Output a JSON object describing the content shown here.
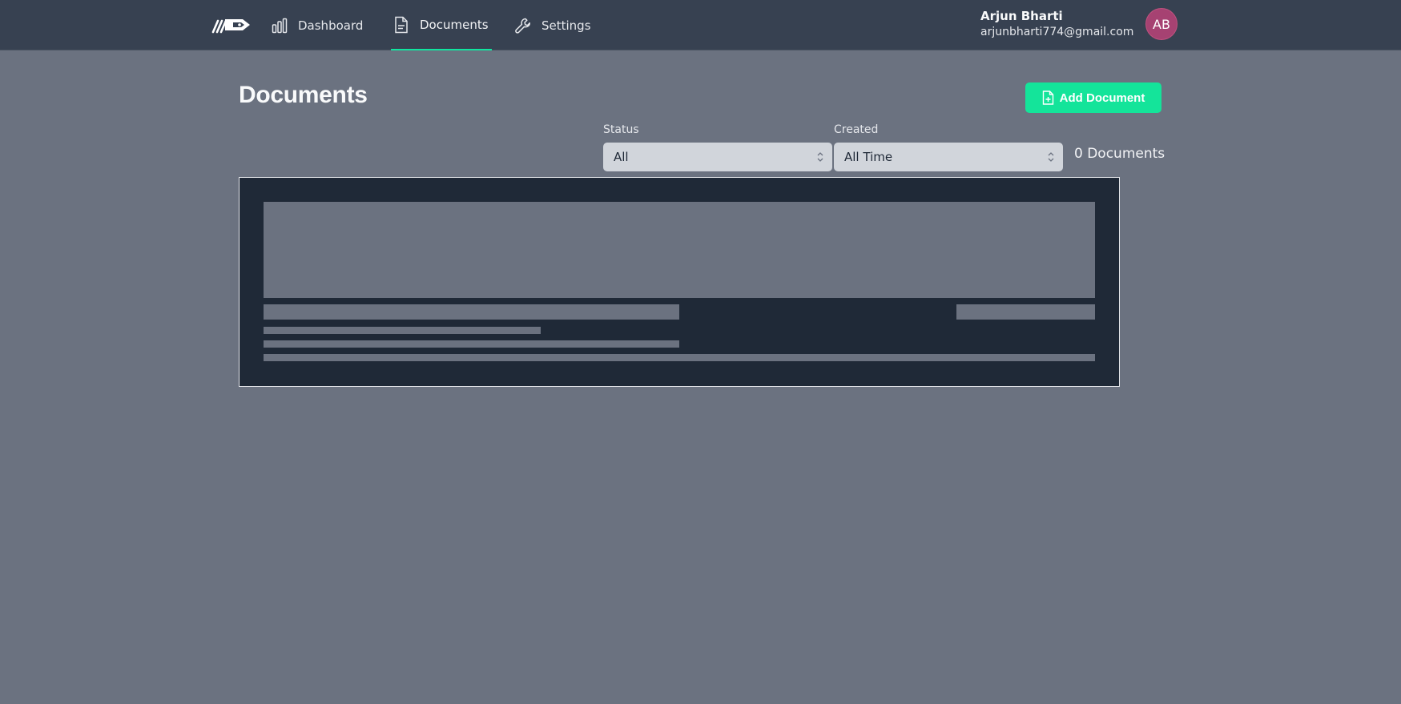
{
  "nav": {
    "items": [
      {
        "label": "Dashboard",
        "icon": "bar-chart-icon"
      },
      {
        "label": "Documents",
        "icon": "document-icon",
        "active": true
      },
      {
        "label": "Settings",
        "icon": "wrench-icon"
      }
    ]
  },
  "user": {
    "name": "Arjun Bharti",
    "email": "arjunbharti774@gmail.com",
    "initials": "AB",
    "avatar_color": "#a64272"
  },
  "page": {
    "title": "Documents",
    "add_button_label": "Add Document"
  },
  "filters": {
    "status": {
      "label": "Status",
      "value": "All"
    },
    "created": {
      "label": "Created",
      "value": "All Time"
    }
  },
  "document_count": "0 Documents",
  "colors": {
    "accent": "#14e49a",
    "nav_bg": "#374151",
    "page_bg": "#6b7280",
    "card_bg": "#1f2937"
  }
}
